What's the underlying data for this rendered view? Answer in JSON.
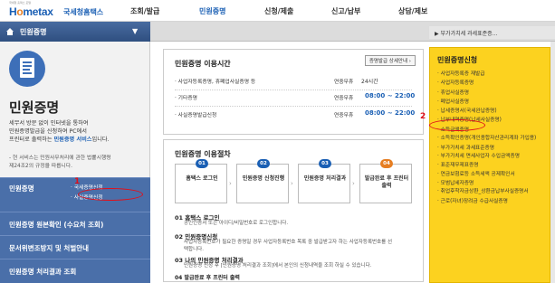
{
  "header": {
    "logo_tag": "국세청 홈택스 포털",
    "logo_main_prefix": "H",
    "logo_main_o": "o",
    "logo_main_suffix": "me",
    "logo_main_end": "tax",
    "logo_sub": "국세청홈택스",
    "nav": [
      "조회/발급",
      "민원증명",
      "신청/제출",
      "신고/납부",
      "상담/제보"
    ]
  },
  "titlebar": {
    "title": "민원증명",
    "right_text": "부가가치세 과세표준증..."
  },
  "sidebar": {
    "title": "민원증명",
    "desc_line1": "세무서 방문 없이 인터넷을 통하여",
    "desc_line2": "민원증명발급을 신청하여 PC에서",
    "desc_line3_prefix": "프린터로 출력하는 ",
    "desc_line3_hl": "민원증명 서비스",
    "desc_line3_suffix": "입니다.",
    "note_line1": "- 현 서비스는 민원사무처리에 관한 법률시행령",
    "note_line2": "제24조2의 규정을 따릅니다.",
    "menu": [
      {
        "label": "민원증명",
        "subs": [
          "국세증명신청",
          "사실증명신청"
        ]
      },
      {
        "label": "민원증명 원본확인 (수요처 조회)"
      },
      {
        "label": "문서위변조방지 및 처벌안내"
      },
      {
        "label": "민원증명 처리결과 조회"
      }
    ]
  },
  "hours": {
    "title": "민원증명 이용시간",
    "view_button": "증명발급 상세안내 ›",
    "rows": [
      {
        "label": "· 사업자등록증명, 휴폐업사실증명 등",
        "days": "연중무휴",
        "time": "24시간"
      },
      {
        "label": "· 기타증명",
        "days": "연중무휴",
        "time": "08:00 ~ 22:00"
      },
      {
        "label": "· 사실증명발급신청",
        "days": "연중무휴",
        "time": "08:00 ~ 22:00"
      }
    ]
  },
  "procedure": {
    "title": "민원증명 이용절차",
    "steps": [
      {
        "num": "01",
        "label": "홈택스 로그인"
      },
      {
        "num": "02",
        "label": "민원증명 신청진행"
      },
      {
        "num": "03",
        "label": "민원증명 처리결과"
      },
      {
        "num": "04",
        "label": "발급완료 후 프린터 출력"
      }
    ],
    "sections": [
      {
        "title": "01 홈택스 로그인",
        "desc": "공인인증서 또는 아이디/비밀번호로 로그인합니다."
      },
      {
        "title": "02 민원증명신청",
        "desc": "사업자등록번호가 필요한 증명일 경우 사업자등록번호 목록 중 발급받고자 하는 사업자등록번호를 선택합니다."
      },
      {
        "title": "03 나의 민원증명 처리결과",
        "desc": "민원증명 신청 후 [민원증명 처리결과 조회]에서 본인의 신청내역을 조회 하실 수 있습니다."
      },
      {
        "title": "04 발급완료 후 프린터 출력",
        "desc": ""
      }
    ]
  },
  "right_panel": {
    "title": "민원증명신청",
    "items": [
      "· 사업자등록증 재발급",
      "· 사업자등록증명",
      "· 휴업사실증명",
      "· 폐업사실증명",
      "· 납세증명서(국세완납증명)",
      "· 납부내역증명(납세사실증명)",
      "· 소득금액증명",
      "· 소득확인증명(개인종합자산관리계좌 가입용)",
      "· 부가가치세 과세표준증명",
      "· 부가가치세 면세사업자 수입금액증명",
      "· 표준재무제표증명",
      "· 연금보험료등 소득세액 공제확인서",
      "· 모범납세자증명",
      "· 취업후학자금상환_상환금납부사실증명서",
      "· 근로(자녀)장려금 수급사실증명"
    ]
  },
  "annotations": {
    "one": "1",
    "two": "2"
  },
  "colors": {
    "brand": "#1a5fb4",
    "menu": "#4a6fa9",
    "right_panel": "#fcd21f",
    "annotation": "#e0101a"
  }
}
